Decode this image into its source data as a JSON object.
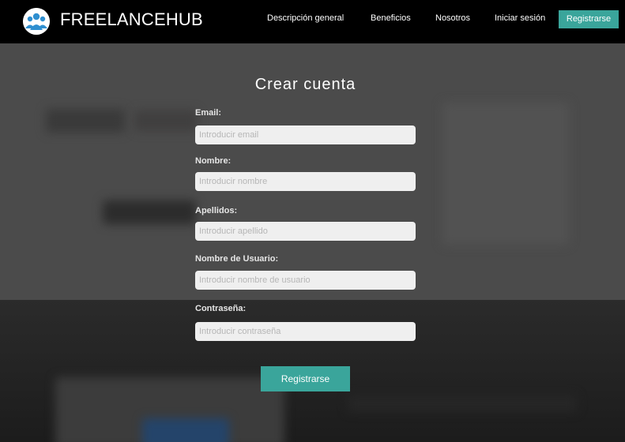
{
  "brand": {
    "name": "FREELANCEHUB",
    "icon": "users-group-icon"
  },
  "nav": {
    "links": [
      "Descripción general",
      "Beneficios",
      "Nosotros",
      "Iniciar sesión"
    ],
    "register_label": "Registrarse"
  },
  "form": {
    "title": "Crear cuenta",
    "fields": [
      {
        "label": "Email:",
        "placeholder": "Introducir email",
        "value": ""
      },
      {
        "label": "Nombre:",
        "placeholder": "Introducir nombre",
        "value": ""
      },
      {
        "label": "Apellidos:",
        "placeholder": "Introducir apellido",
        "value": ""
      },
      {
        "label": "Nombre de Usuario:",
        "placeholder": "Introducir nombre de usuario",
        "value": ""
      },
      {
        "label": "Contraseña:",
        "placeholder": "Introducir contraseña",
        "value": ""
      }
    ],
    "submit_label": "Registrarse"
  },
  "colors": {
    "accent": "#3aa59b",
    "nav_bg": "#000000",
    "overlay_top": "#4b4b4b",
    "overlay_bottom": "#1c1c1c",
    "logo_icon": "#2f8fd0"
  }
}
